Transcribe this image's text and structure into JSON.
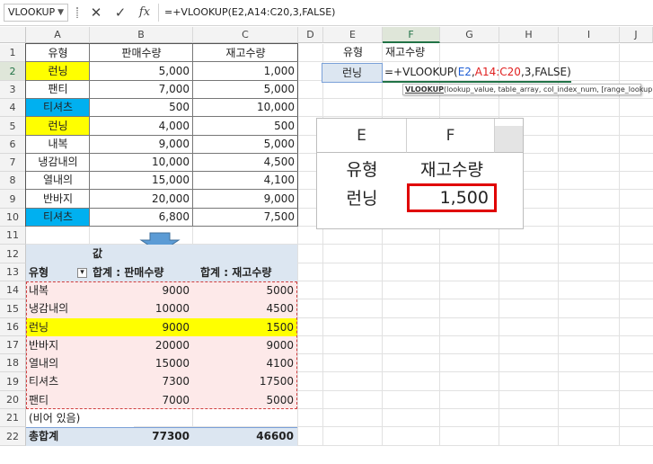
{
  "namebox": {
    "value": "VLOOKUP",
    "dropdown_icon": "▼"
  },
  "formula_bar": {
    "cancel_icon": "✕",
    "enter_icon": "✓",
    "fx_label": "fx",
    "formula": "=+VLOOKUP(E2,A14:C20,3,FALSE)"
  },
  "columns": [
    "A",
    "B",
    "C",
    "D",
    "E",
    "F",
    "G",
    "H",
    "I",
    "J"
  ],
  "rows": [
    "1",
    "2",
    "3",
    "4",
    "5",
    "6",
    "7",
    "8",
    "9",
    "10",
    "11",
    "12",
    "13",
    "14",
    "15",
    "16",
    "17",
    "18",
    "19",
    "20",
    "21",
    "22"
  ],
  "table": {
    "headers": [
      "유형",
      "판매수량",
      "재고수량"
    ],
    "rows": [
      {
        "type": "런닝",
        "sales": "5,000",
        "stock": "1,000",
        "color": "#ffff00"
      },
      {
        "type": "팬티",
        "sales": "7,000",
        "stock": "5,000",
        "color": ""
      },
      {
        "type": "티셔츠",
        "sales": "500",
        "stock": "10,000",
        "color": "#00b0f0"
      },
      {
        "type": "런닝",
        "sales": "4,000",
        "stock": "500",
        "color": "#ffff00"
      },
      {
        "type": "내복",
        "sales": "9,000",
        "stock": "5,000",
        "color": ""
      },
      {
        "type": "냉감내의",
        "sales": "10,000",
        "stock": "4,500",
        "color": ""
      },
      {
        "type": "열내의",
        "sales": "15,000",
        "stock": "4,100",
        "color": ""
      },
      {
        "type": "반바지",
        "sales": "20,000",
        "stock": "9,000",
        "color": ""
      },
      {
        "type": "티셔츠",
        "sales": "6,800",
        "stock": "7,500",
        "color": "#00b0f0"
      }
    ]
  },
  "lookup": {
    "header_e": "유형",
    "header_f": "재고수량",
    "value_e": "런닝",
    "edit_prefix": "=+VLOOKUP(",
    "edit_arg1": "E2",
    "edit_comma": ",",
    "edit_arg2": "A14:C20",
    "edit_rest": ",3,FALSE)",
    "tooltip_fn": "VLOOKUP",
    "tooltip_args": "(lookup_value, table_array, col_index_num, [range_lookup])"
  },
  "arrow_icon": "down-arrow",
  "pivot": {
    "values_label": "값",
    "row_label": "유형",
    "filter_icon": "▾",
    "col1": "합계 : 판매수량",
    "col2": "합계 : 재고수량",
    "rows": [
      {
        "type": "내복",
        "sales": "9000",
        "stock": "5000",
        "highlight": false
      },
      {
        "type": "냉감내의",
        "sales": "10000",
        "stock": "4500",
        "highlight": false
      },
      {
        "type": "런닝",
        "sales": "9000",
        "stock": "1500",
        "highlight": true
      },
      {
        "type": "반바지",
        "sales": "20000",
        "stock": "9000",
        "highlight": false
      },
      {
        "type": "열내의",
        "sales": "15000",
        "stock": "4100",
        "highlight": false
      },
      {
        "type": "티셔츠",
        "sales": "7300",
        "stock": "17500",
        "highlight": false
      },
      {
        "type": "팬티",
        "sales": "7000",
        "stock": "5000",
        "highlight": false
      }
    ],
    "blank_label": "(비어 있음)",
    "total_label": "총합계",
    "total_sales": "77300",
    "total_stock": "46600"
  },
  "zoom": {
    "col_e": "E",
    "col_f": "F",
    "label_type": "유형",
    "label_stock": "재고수량",
    "value_type": "런닝",
    "value_stock": "1,500",
    "result_border_color": "#e00000"
  },
  "colors": {
    "accent": "#217346",
    "yellow": "#ffff00",
    "cyan": "#00b0f0",
    "pivot_header": "#dce6f1",
    "pivot_body": "#fde9e9",
    "arg_blue": "#1f5fd6",
    "arg_red": "#e02020"
  }
}
